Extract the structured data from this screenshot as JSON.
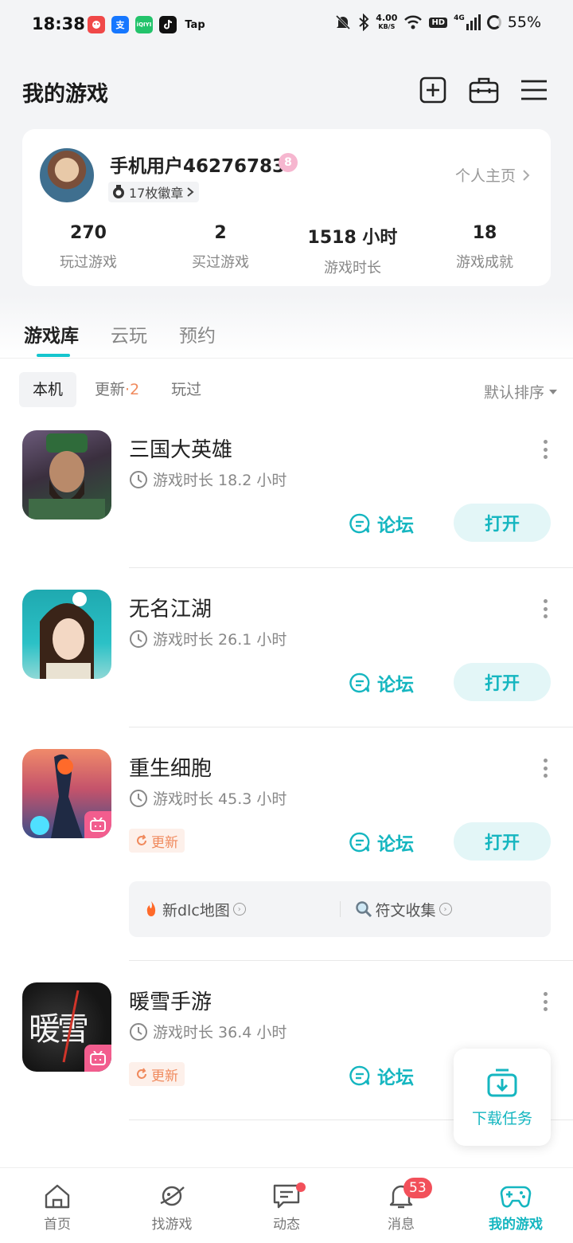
{
  "status_bar": {
    "time": "18:38",
    "net_speed_value": "4.00",
    "net_speed_unit": "KB/S",
    "hd": "HD",
    "signal": "4G",
    "battery": "55%",
    "notif_apps": [
      "app-icon-red",
      "alipay-icon",
      "iqiyi-icon",
      "tiktok-icon",
      "taptap-icon"
    ],
    "tap_label": "Tap",
    "alipay_label": "支",
    "iqiyi_label": "iQIYI"
  },
  "header": {
    "title": "我的游戏",
    "icons": [
      "add-icon",
      "toolbox-icon",
      "menu-icon"
    ]
  },
  "profile": {
    "username": "手机用户46276783",
    "level": "8",
    "badges": "17枚徽章",
    "homepage_link": "个人主页",
    "stats": [
      {
        "value": "270",
        "label": "玩过游戏"
      },
      {
        "value": "2",
        "label": "买过游戏"
      },
      {
        "value": "1518 小时",
        "label": "游戏时长"
      },
      {
        "value": "18",
        "label": "游戏成就"
      }
    ]
  },
  "tabs": {
    "main": [
      "游戏库",
      "云玩",
      "预约"
    ],
    "sub": {
      "local": "本机",
      "update": "更新",
      "update_count": "·2",
      "played": "玩过"
    },
    "sort": "默认排序"
  },
  "games": [
    {
      "name": "三国大英雄",
      "playtime": "游戏时长 18.2 小时",
      "forum": "论坛",
      "open": "打开"
    },
    {
      "name": "无名江湖",
      "playtime": "游戏时长 26.1 小时",
      "forum": "论坛",
      "open": "打开"
    },
    {
      "name": "重生细胞",
      "playtime": "游戏时长 45.3 小时",
      "forum": "论坛",
      "open": "打开",
      "update_tag": "更新",
      "news": [
        "新dlc地图",
        "符文收集"
      ]
    },
    {
      "name": "暖雪手游",
      "playtime": "游戏时长 36.4 小时",
      "forum": "论坛",
      "update_tag": "更新",
      "icon_text": "暖雪"
    }
  ],
  "download_float": {
    "label": "下载任务"
  },
  "bottom_nav": [
    {
      "label": "首页"
    },
    {
      "label": "找游戏"
    },
    {
      "label": "动态"
    },
    {
      "label": "消息",
      "badge": "53"
    },
    {
      "label": "我的游戏"
    }
  ],
  "colors": {
    "accent": "#15b6c0",
    "update": "#f08a5d",
    "badge": "#f2505a"
  }
}
